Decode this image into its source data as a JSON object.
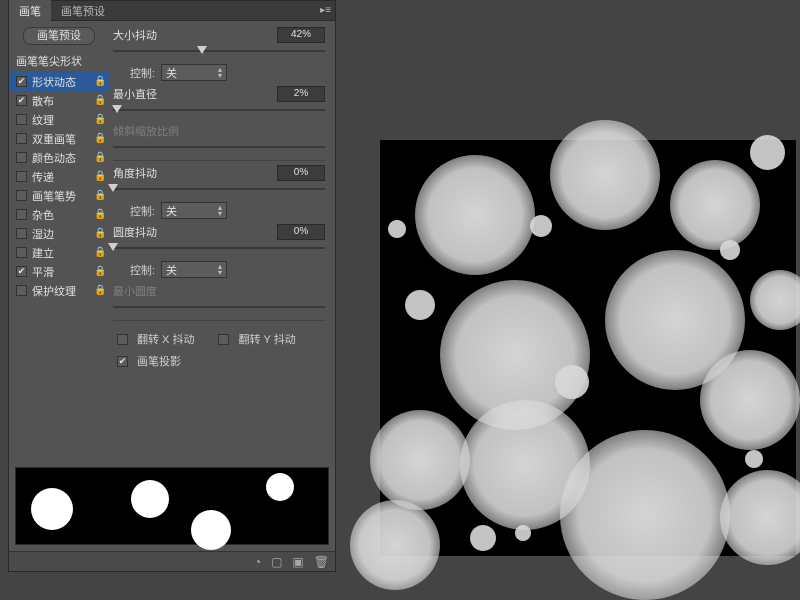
{
  "tabs": {
    "brush": "画笔",
    "presets": "画笔预设"
  },
  "preset_button": "画笔预设",
  "tip_shape": "画笔笔尖形状",
  "options": [
    {
      "label": "形状动态",
      "checked": true,
      "locked": true,
      "selected": true
    },
    {
      "label": "散布",
      "checked": true,
      "locked": true
    },
    {
      "label": "纹理",
      "checked": false,
      "locked": true
    },
    {
      "label": "双重画笔",
      "checked": false,
      "locked": true
    },
    {
      "label": "颜色动态",
      "checked": false,
      "locked": true
    },
    {
      "label": "传递",
      "checked": false,
      "locked": true
    },
    {
      "label": "画笔笔势",
      "checked": false,
      "locked": true
    },
    {
      "label": "杂色",
      "checked": false,
      "locked": true
    },
    {
      "label": "湿边",
      "checked": false,
      "locked": true
    },
    {
      "label": "建立",
      "checked": false,
      "locked": true
    },
    {
      "label": "平滑",
      "checked": true,
      "locked": true
    },
    {
      "label": "保护纹理",
      "checked": false,
      "locked": true
    }
  ],
  "settings": {
    "size_jitter": {
      "label": "大小抖动",
      "value": "42%",
      "pos": 42
    },
    "control1": {
      "label": "控制:",
      "value": "关"
    },
    "min_diameter": {
      "label": "最小直径",
      "value": "2%",
      "pos": 2
    },
    "tilt_scale": {
      "label": "倾斜缩放比例"
    },
    "angle_jitter": {
      "label": "角度抖动",
      "value": "0%",
      "pos": 0
    },
    "control2": {
      "label": "控制:",
      "value": "关"
    },
    "roundness_jitter": {
      "label": "圆度抖动",
      "value": "0%",
      "pos": 0
    },
    "control3": {
      "label": "控制:",
      "value": "关"
    },
    "min_roundness": {
      "label": "最小圆度"
    },
    "flip_x": {
      "label": "翻转 X 抖动",
      "checked": false
    },
    "flip_y": {
      "label": "翻转 Y 抖动",
      "checked": false
    },
    "brush_projection": {
      "label": "画笔投影",
      "checked": true
    }
  }
}
